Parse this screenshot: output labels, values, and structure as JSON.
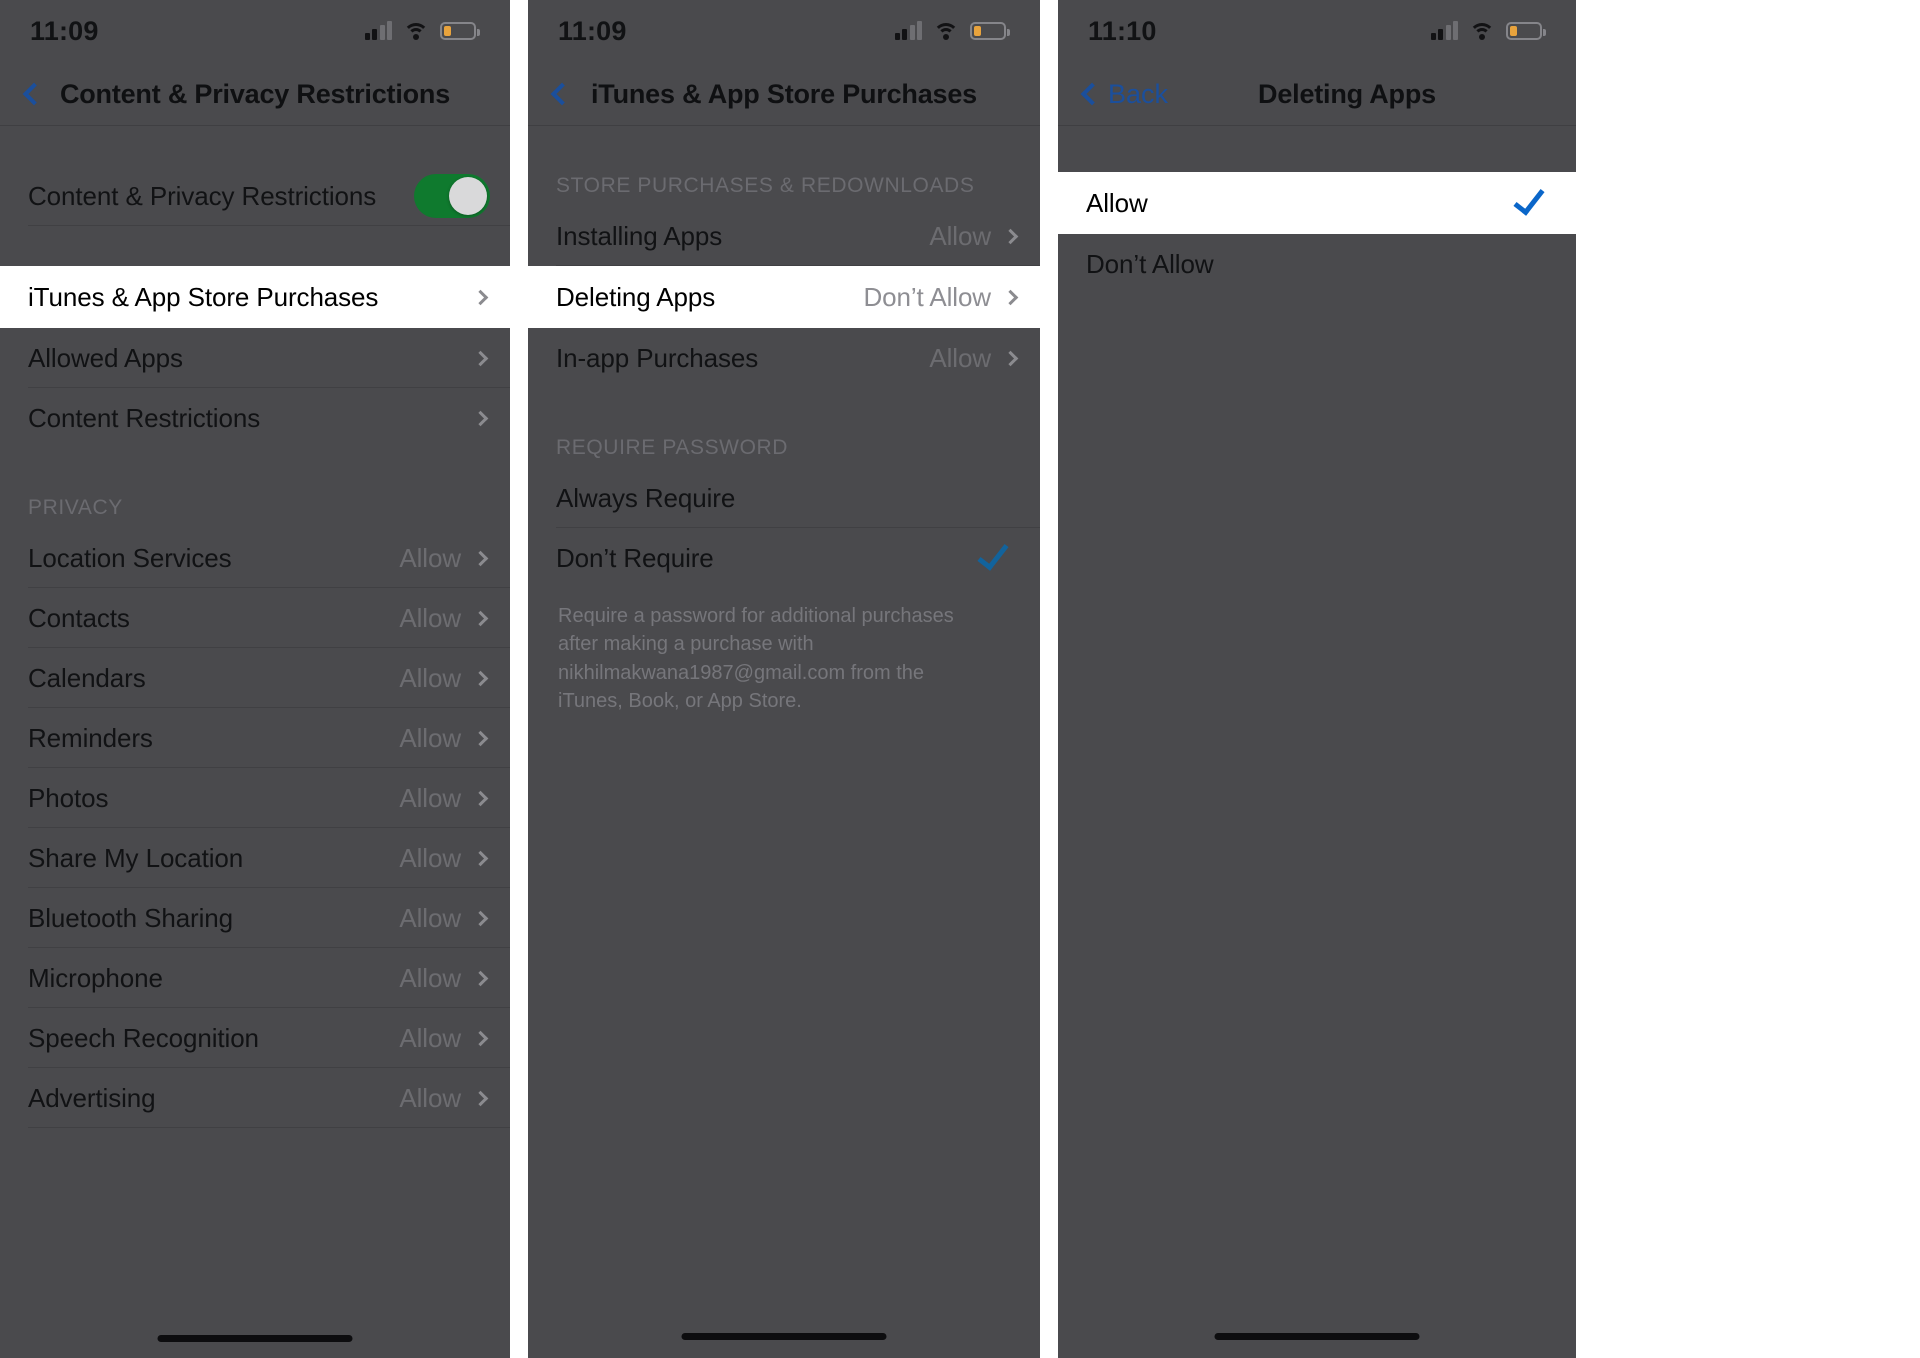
{
  "panels": [
    {
      "id": "content-privacy-restrictions",
      "status": {
        "time": "11:09"
      },
      "nav": {
        "back_label": "",
        "title": "Content & Privacy Restrictions"
      },
      "toggle_row": {
        "label": "Content & Privacy Restrictions",
        "state": "on",
        "color": "#0f7a2e"
      },
      "rows": [
        {
          "label": "iTunes & App Store Purchases",
          "value": "",
          "chevron": true,
          "highlighted": true
        },
        {
          "label": "Allowed Apps",
          "value": "",
          "chevron": true,
          "highlighted": false
        },
        {
          "label": "Content Restrictions",
          "value": "",
          "chevron": true,
          "highlighted": false
        }
      ],
      "privacy_header": "PRIVACY",
      "privacy_rows": [
        {
          "label": "Location Services",
          "value": "Allow",
          "chevron": true
        },
        {
          "label": "Contacts",
          "value": "Allow",
          "chevron": true
        },
        {
          "label": "Calendars",
          "value": "Allow",
          "chevron": true
        },
        {
          "label": "Reminders",
          "value": "Allow",
          "chevron": true
        },
        {
          "label": "Photos",
          "value": "Allow",
          "chevron": true
        },
        {
          "label": "Share My Location",
          "value": "Allow",
          "chevron": true
        },
        {
          "label": "Bluetooth Sharing",
          "value": "Allow",
          "chevron": true
        },
        {
          "label": "Microphone",
          "value": "Allow",
          "chevron": true
        },
        {
          "label": "Speech Recognition",
          "value": "Allow",
          "chevron": true
        },
        {
          "label": "Advertising",
          "value": "Allow",
          "chevron": true
        }
      ]
    },
    {
      "id": "itunes-app-store-purchases",
      "status": {
        "time": "11:09"
      },
      "nav": {
        "back_label": "",
        "title": "iTunes & App Store Purchases"
      },
      "section_header": "STORE PURCHASES & REDOWNLOADS",
      "store_rows": [
        {
          "label": "Installing Apps",
          "value": "Allow",
          "chevron": true,
          "highlighted": false
        },
        {
          "label": "Deleting Apps",
          "value": "Don’t Allow",
          "chevron": true,
          "highlighted": true
        },
        {
          "label": "In-app Purchases",
          "value": "Allow",
          "chevron": true,
          "highlighted": false
        }
      ],
      "password_header": "REQUIRE PASSWORD",
      "password_rows": [
        {
          "label": "Always Require",
          "checked": false
        },
        {
          "label": "Don’t Require",
          "checked": true
        }
      ],
      "footnote": "Require a password for additional purchases after making a purchase with nikhilmakwana1987@gmail.com from the iTunes, Book, or App Store."
    },
    {
      "id": "deleting-apps",
      "status": {
        "time": "11:10"
      },
      "nav": {
        "back_label": "Back",
        "title": "Deleting Apps"
      },
      "options": [
        {
          "label": "Allow",
          "checked": true,
          "highlighted": true
        },
        {
          "label": "Don’t Allow",
          "checked": false,
          "highlighted": false
        }
      ]
    }
  ],
  "icons": {
    "back_chevron": "chevron-left-icon",
    "row_chevron": "chevron-right-icon",
    "checkmark": "checkmark-icon",
    "signal": "cellular-signal-icon",
    "wifi": "wifi-icon",
    "battery": "battery-low-icon"
  },
  "colors": {
    "accent_blue": "#1b4f9c",
    "check_blue": "#0a66c9",
    "toggle_green": "#0f7a2e",
    "dim_overlay": "#4a4a4d",
    "battery_warning": "#e8a33d"
  }
}
